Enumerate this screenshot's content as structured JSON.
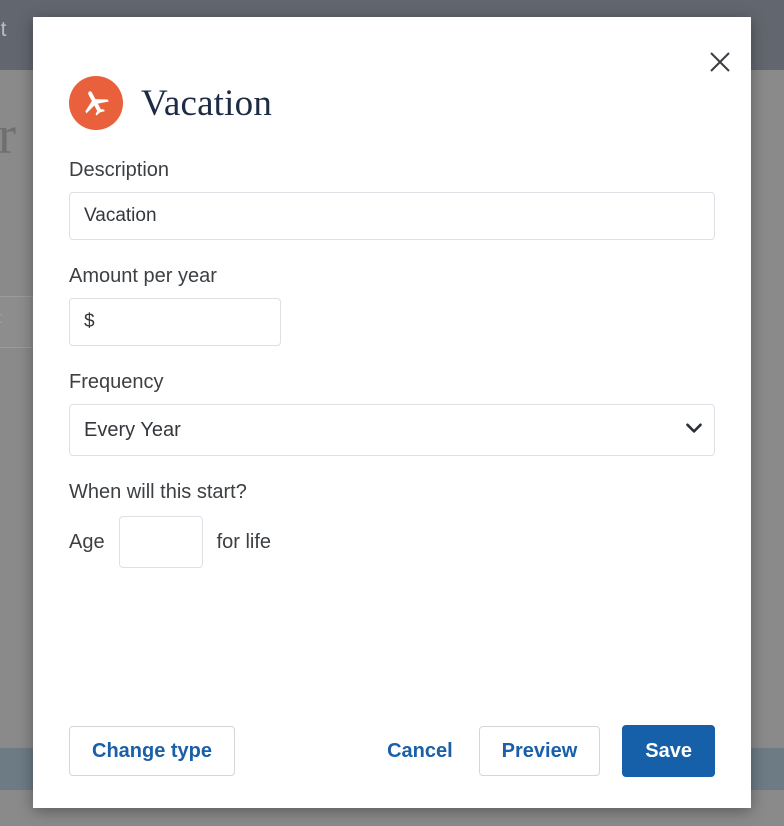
{
  "background": {
    "topbar_text": "est",
    "heading_text": "ar",
    "card_text": "art",
    "topbar_color": "#62676f",
    "body_color": "#8a8a8a",
    "footer_band_color": "#6d7b85"
  },
  "modal": {
    "title": "Vacation",
    "title_icon": "airplane-icon",
    "title_icon_color": "#e8613c",
    "close_icon": "close-icon",
    "fields": {
      "description": {
        "label": "Description",
        "value": "Vacation",
        "placeholder": ""
      },
      "amount": {
        "label": "Amount per year",
        "value": "$",
        "placeholder": "$"
      },
      "frequency": {
        "label": "Frequency",
        "value": "Every Year",
        "options": [
          "Every Year"
        ]
      },
      "start": {
        "label": "When will this start?",
        "age_prefix": "Age",
        "age_value": "",
        "suffix": "for life"
      }
    },
    "buttons": {
      "change_type": "Change type",
      "cancel": "Cancel",
      "preview": "Preview",
      "save": "Save"
    },
    "accent_color": "#1560a8",
    "link_color": "#1a5fa8"
  }
}
